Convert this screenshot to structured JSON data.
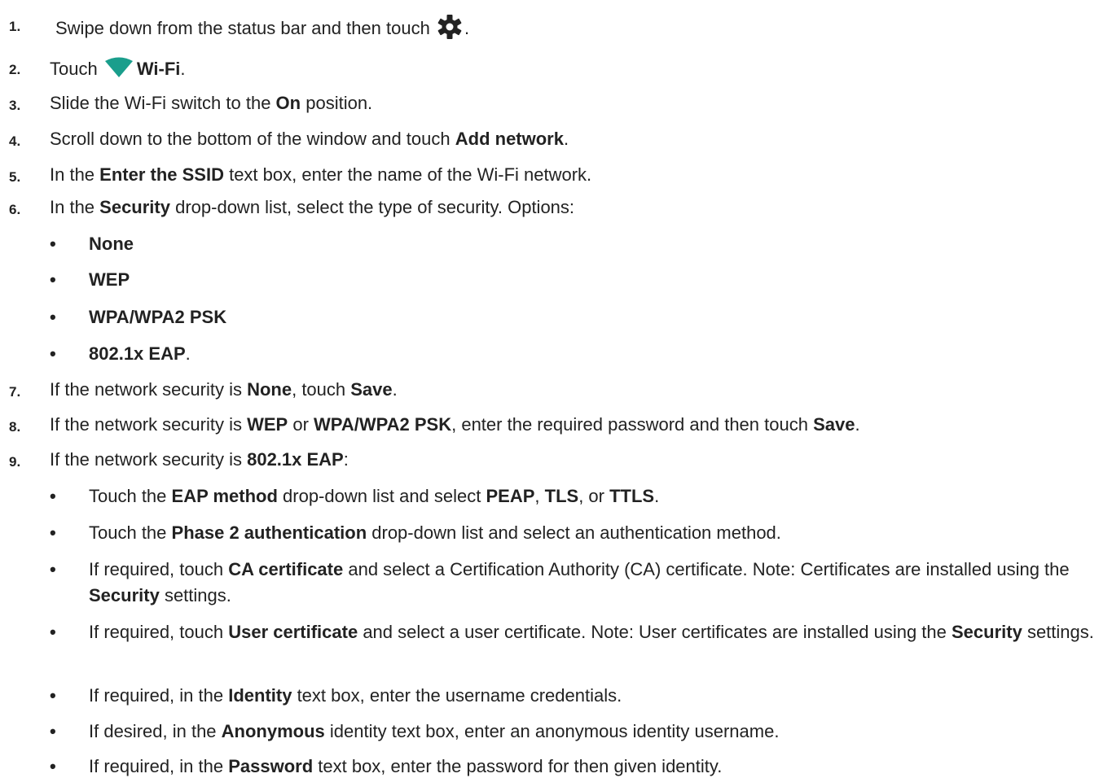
{
  "steps": [
    {
      "num": "1.",
      "a": "Swipe down from the status bar and then touch ",
      "icon": "gear-icon",
      "b": "."
    },
    {
      "num": "2.",
      "a": "Touch ",
      "icon": "wifi-icon",
      "bold1": "Wi-Fi",
      "b": "."
    },
    {
      "num": "3.",
      "a": "Slide the Wi-Fi switch to the ",
      "bold1": "On",
      "b": " position."
    },
    {
      "num": "4.",
      "a": "Scroll down to the bottom of the window and touch ",
      "bold1": "Add network",
      "b": "."
    },
    {
      "num": "5.",
      "a": "In the ",
      "bold1": "Enter the SSID",
      "b": " text box, enter the name of the Wi-Fi network."
    },
    {
      "num": "6.",
      "a": "In the ",
      "bold1": "Security",
      "b": " drop-down list, select the type of security. Options:"
    },
    {
      "num": "7.",
      "a": "If the network security is ",
      "bold1": "None",
      "b": ", touch ",
      "bold2": "Save",
      "c": "."
    },
    {
      "num": "8.",
      "a": "If the network security is ",
      "bold1": "WEP",
      "b": " or ",
      "bold2": "WPA/WPA2 PSK",
      "c": ", enter the required password and then touch ",
      "bold3": "Save",
      "d": "."
    },
    {
      "num": "9.",
      "a": "If the network security is ",
      "bold1": "802.1x EAP",
      "b": ":"
    }
  ],
  "options": [
    {
      "bold": "None",
      "tail": ""
    },
    {
      "bold": "WEP",
      "tail": ""
    },
    {
      "bold": "WPA/WPA2 PSK",
      "tail": ""
    },
    {
      "bold": "802.1x EAP",
      "tail": "."
    }
  ],
  "eap": [
    {
      "a": "Touch the ",
      "bold1": "EAP method",
      "b": " drop-down list and select ",
      "bold2": "PEAP",
      "c": ", ",
      "bold3": "TLS",
      "d": ", or ",
      "bold4": "TTLS",
      "e": "."
    },
    {
      "a": "Touch the ",
      "bold1": "Phase 2 authentication",
      "b": " drop-down list and select an authentication method."
    },
    {
      "a": "If required, touch ",
      "bold1": "CA certificate",
      "b": " and select a Certification Authority (CA) certificate. Note: Certificates are installed using the ",
      "bold2": "Security",
      "c": " settings."
    },
    {
      "a": "If required, touch ",
      "bold1": "User certificate",
      "b": " and select a user certificate. Note: User certificates are installed using the ",
      "bold2": "Security",
      "c": " settings."
    },
    {
      "a": "If required, in the ",
      "bold1": "Identity",
      "b": " text box, enter the username credentials."
    },
    {
      "a": "If desired, in the ",
      "bold1": "Anonymous",
      "b": " identity text box, enter an anonymous identity username."
    },
    {
      "a": "If required, in the ",
      "bold1": "Password",
      "b": " text box, enter the password for then given identity."
    }
  ],
  "bullet": "•",
  "colors": {
    "wifi": "#1a9e8c",
    "gear": "#222222",
    "text": "#222222"
  }
}
